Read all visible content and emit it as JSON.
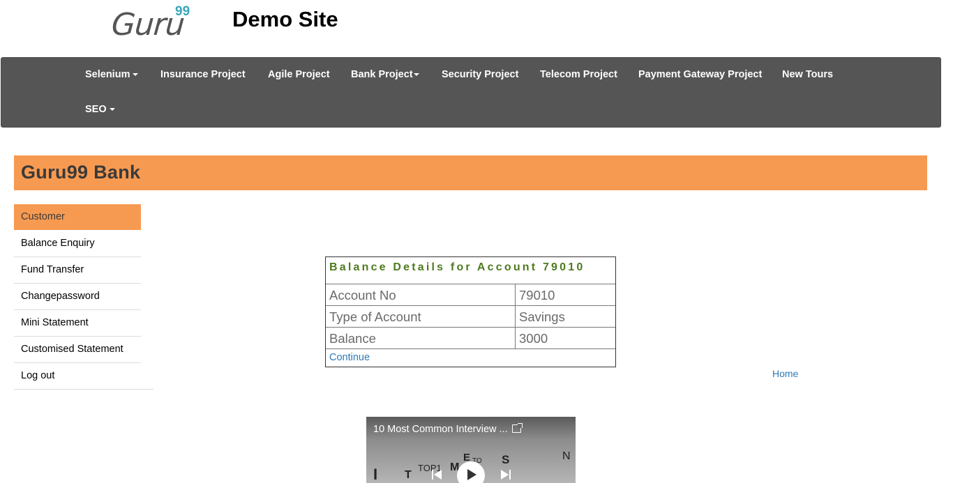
{
  "header": {
    "logo_text": "Guru",
    "logo_sup": "99",
    "site_title": "Demo Site"
  },
  "navbar": {
    "items": [
      {
        "label": "Selenium",
        "has_caret": true
      },
      {
        "label": "Insurance Project",
        "has_caret": false
      },
      {
        "label": "Agile Project",
        "has_caret": false
      },
      {
        "label": "Bank Project",
        "has_caret": true
      },
      {
        "label": "Security Project",
        "has_caret": false
      },
      {
        "label": "Telecom Project",
        "has_caret": false
      },
      {
        "label": "Payment Gateway Project",
        "has_caret": false
      },
      {
        "label": "New Tours",
        "has_caret": false
      },
      {
        "label": "SEO",
        "has_caret": true
      }
    ]
  },
  "bank": {
    "title": "Guru99 Bank"
  },
  "sidebar": {
    "items": [
      {
        "label": "Customer",
        "active": true
      },
      {
        "label": "Balance Enquiry",
        "active": false
      },
      {
        "label": "Fund Transfer",
        "active": false
      },
      {
        "label": "Changepassword",
        "active": false
      },
      {
        "label": "Mini Statement",
        "active": false
      },
      {
        "label": "Customised Statement",
        "active": false
      },
      {
        "label": "Log out",
        "active": false
      }
    ]
  },
  "balance": {
    "heading": "Balance Details for Account 79010",
    "rows": [
      {
        "label": "Account No",
        "value": "79010"
      },
      {
        "label": "Type of Account",
        "value": "Savings"
      },
      {
        "label": "Balance",
        "value": "3000"
      }
    ],
    "continue_label": "Continue"
  },
  "home_link": "Home",
  "video": {
    "title": "10 Most Common Interview ...",
    "overlay_text": [
      "TOP1",
      "M",
      "E",
      "TO",
      "S",
      "N",
      "T",
      "I"
    ]
  },
  "colors": {
    "accent_orange": "#f79a51",
    "navbar_bg": "#555555",
    "heading_green": "#4e7a1e",
    "link_blue": "#2f79b5",
    "logo_teal": "#3aa6b9"
  }
}
